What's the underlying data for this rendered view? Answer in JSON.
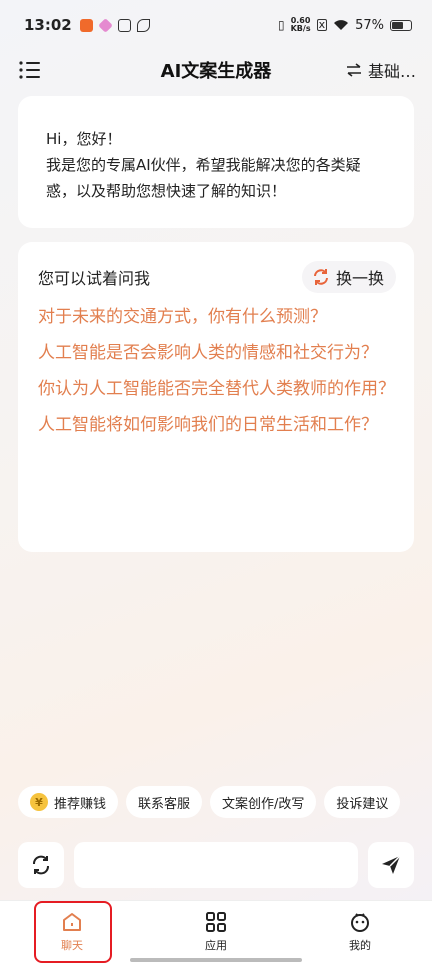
{
  "status_bar": {
    "time": "13:02",
    "net_speed_value": "0.60",
    "net_speed_unit": "KB/s",
    "battery": "57%",
    "battery_level": 0.57
  },
  "header": {
    "title": "AI文案生成器",
    "model_label": "基础…"
  },
  "greeting": {
    "line1": "Hi，您好！",
    "line2": "我是您的专属AI伙伴，希望我能解决您的各类疑",
    "line3": "惑，以及帮助您想快速了解的知识！"
  },
  "suggestions": {
    "title": "您可以试着问我",
    "refresh_label": "换一换",
    "questions": [
      "对于未来的交通方式，你有什么预测？",
      "人工智能是否会影响人类的情感和社交行为？",
      "你认为人工智能能否完全替代人类教师的作用？",
      "人工智能将如何影响我们的日常生活和工作？"
    ]
  },
  "chips": [
    "推荐赚钱",
    "联系客服",
    "文案创作/改写",
    "投诉建议"
  ],
  "input": {
    "placeholder": ""
  },
  "tabbar": {
    "tabs": [
      "聊天",
      "应用",
      "我的"
    ],
    "active": "聊天"
  },
  "colors": {
    "accent": "#e27f4f",
    "highlight_border": "#e51c23"
  }
}
